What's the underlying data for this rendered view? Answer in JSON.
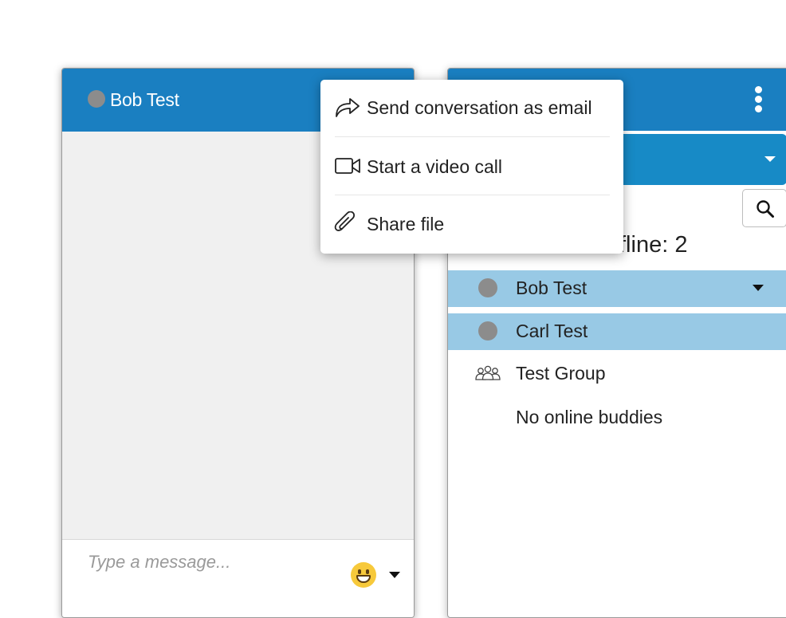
{
  "chat": {
    "title": "Bob Test",
    "input_placeholder": "Type a message...",
    "status_color": "#8c8c8c",
    "header_color": "#1a7fc1"
  },
  "menu": {
    "items": [
      {
        "label": "Send conversation as email",
        "icon": "share-arrow-icon"
      },
      {
        "label": "Start a video call",
        "icon": "video-camera-icon"
      },
      {
        "label": "Share file",
        "icon": "paperclip-icon"
      }
    ]
  },
  "buddy_list": {
    "offline_label": "fline: 2",
    "buddies": [
      {
        "name": "Bob Test",
        "status": "offline",
        "selected": true
      },
      {
        "name": "Carl Test",
        "status": "offline",
        "selected": true
      }
    ],
    "group": {
      "name": "Test Group",
      "icon": "group-icon"
    },
    "empty_message": "No online buddies",
    "selected_row_color": "#98c9e5"
  }
}
